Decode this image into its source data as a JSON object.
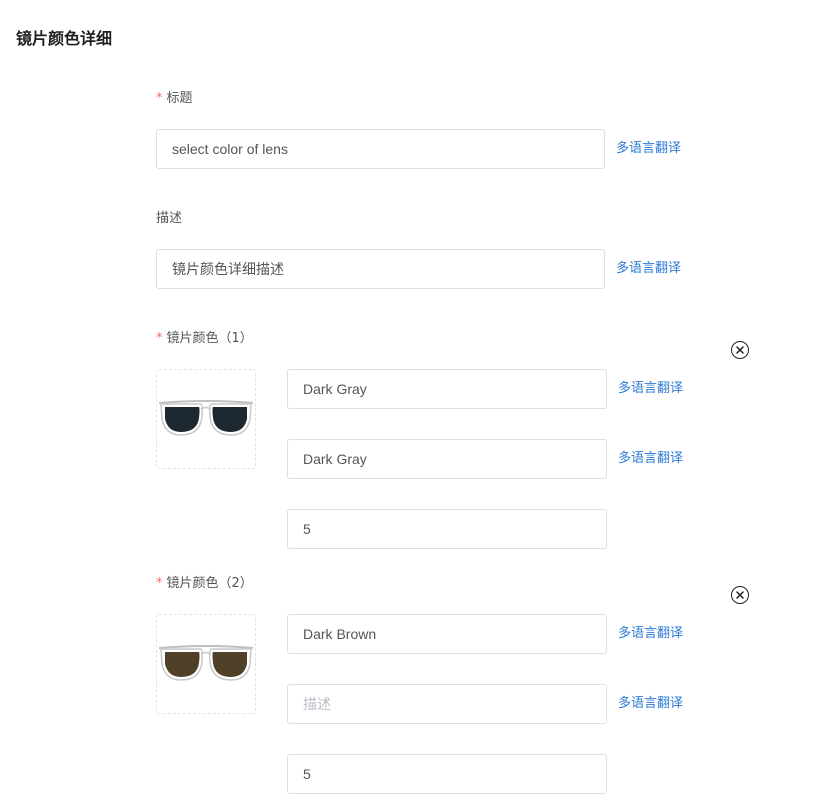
{
  "page": {
    "title": "镜片颜色详细"
  },
  "title_field": {
    "label": "标题",
    "value": "select color of lens",
    "translate": "多语言翻译"
  },
  "desc_field": {
    "label": "描述",
    "value": "镜片颜色详细描述",
    "translate": "多语言翻译"
  },
  "colors": [
    {
      "label": "镜片颜色（1）",
      "name": "Dark Gray",
      "desc": "Dark Gray",
      "desc_placeholder": "描述",
      "qty": "5",
      "translate": "多语言翻译",
      "lens_color": "#1e2830"
    },
    {
      "label": "镜片颜色（2）",
      "name": "Dark Brown",
      "desc": "",
      "desc_placeholder": "描述",
      "qty": "5",
      "translate": "多语言翻译",
      "lens_color": "#4f4127"
    }
  ],
  "theme": {
    "accent": "#2d7ad6",
    "required": "#f56c6c",
    "border": "#dcdfe6"
  }
}
